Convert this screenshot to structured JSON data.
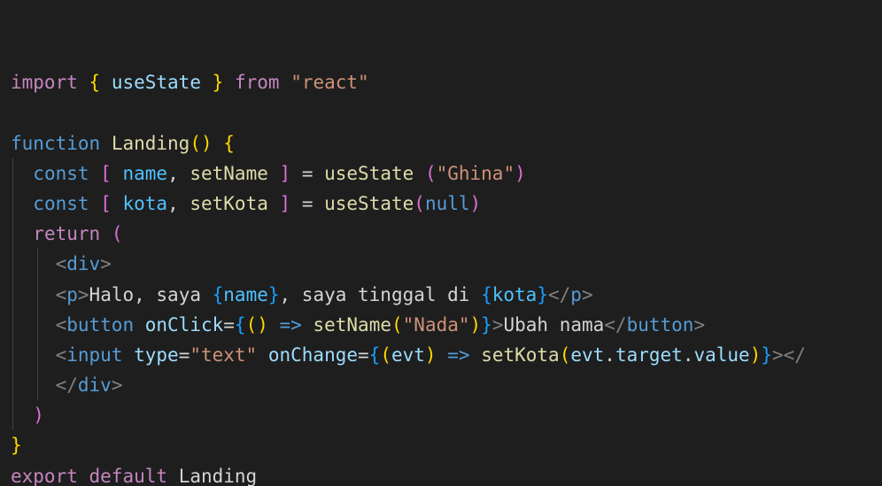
{
  "colors": {
    "background": "#1e1e1e",
    "keyword_control": "#c586c0",
    "keyword_storage": "#569cd6",
    "function": "#dcdcaa",
    "variable": "#9cdcfe",
    "constant": "#4fc1ff",
    "string": "#ce9178",
    "tag": "#569cd6",
    "tag_bracket": "#808080",
    "text": "#d4d4d4",
    "bracket_gold": "#ffd700",
    "bracket_violet": "#da70d6",
    "bracket_blue": "#179fff"
  },
  "code_lines": [
    {
      "guides": 0,
      "tokens": []
    },
    {
      "guides": 0,
      "tokens": [
        {
          "t": "import",
          "c": "#c586c0"
        },
        {
          "t": " ",
          "c": "#d4d4d4"
        },
        {
          "t": "{",
          "c": "#ffd700"
        },
        {
          "t": " ",
          "c": "#d4d4d4"
        },
        {
          "t": "useState",
          "c": "#9cdcfe"
        },
        {
          "t": " ",
          "c": "#d4d4d4"
        },
        {
          "t": "}",
          "c": "#ffd700"
        },
        {
          "t": " ",
          "c": "#d4d4d4"
        },
        {
          "t": "from",
          "c": "#c586c0"
        },
        {
          "t": " ",
          "c": "#d4d4d4"
        },
        {
          "t": "\"react\"",
          "c": "#ce9178"
        }
      ]
    },
    {
      "guides": 0,
      "tokens": []
    },
    {
      "guides": 0,
      "tokens": [
        {
          "t": "function",
          "c": "#569cd6"
        },
        {
          "t": " ",
          "c": "#d4d4d4"
        },
        {
          "t": "Landing",
          "c": "#dcdcaa"
        },
        {
          "t": "()",
          "c": "#ffd700"
        },
        {
          "t": " ",
          "c": "#d4d4d4"
        },
        {
          "t": "{",
          "c": "#ffd700"
        }
      ]
    },
    {
      "guides": 1,
      "tokens": [
        {
          "t": "  ",
          "c": "#d4d4d4"
        },
        {
          "t": "const",
          "c": "#569cd6"
        },
        {
          "t": " ",
          "c": "#d4d4d4"
        },
        {
          "t": "[",
          "c": "#da70d6"
        },
        {
          "t": " ",
          "c": "#d4d4d4"
        },
        {
          "t": "name",
          "c": "#4fc1ff"
        },
        {
          "t": ", ",
          "c": "#d4d4d4"
        },
        {
          "t": "setName",
          "c": "#dcdcaa"
        },
        {
          "t": " ",
          "c": "#d4d4d4"
        },
        {
          "t": "]",
          "c": "#da70d6"
        },
        {
          "t": " = ",
          "c": "#d4d4d4"
        },
        {
          "t": "useState",
          "c": "#dcdcaa"
        },
        {
          "t": " ",
          "c": "#d4d4d4"
        },
        {
          "t": "(",
          "c": "#da70d6"
        },
        {
          "t": "\"Ghina\"",
          "c": "#ce9178"
        },
        {
          "t": ")",
          "c": "#da70d6"
        }
      ]
    },
    {
      "guides": 1,
      "tokens": [
        {
          "t": "  ",
          "c": "#d4d4d4"
        },
        {
          "t": "const",
          "c": "#569cd6"
        },
        {
          "t": " ",
          "c": "#d4d4d4"
        },
        {
          "t": "[",
          "c": "#da70d6"
        },
        {
          "t": " ",
          "c": "#d4d4d4"
        },
        {
          "t": "kota",
          "c": "#4fc1ff"
        },
        {
          "t": ", ",
          "c": "#d4d4d4"
        },
        {
          "t": "setKota",
          "c": "#dcdcaa"
        },
        {
          "t": " ",
          "c": "#d4d4d4"
        },
        {
          "t": "]",
          "c": "#da70d6"
        },
        {
          "t": " = ",
          "c": "#d4d4d4"
        },
        {
          "t": "useState",
          "c": "#dcdcaa"
        },
        {
          "t": "(",
          "c": "#da70d6"
        },
        {
          "t": "null",
          "c": "#569cd6"
        },
        {
          "t": ")",
          "c": "#da70d6"
        }
      ]
    },
    {
      "guides": 1,
      "tokens": [
        {
          "t": "  ",
          "c": "#d4d4d4"
        },
        {
          "t": "return",
          "c": "#c586c0"
        },
        {
          "t": " ",
          "c": "#d4d4d4"
        },
        {
          "t": "(",
          "c": "#da70d6"
        }
      ]
    },
    {
      "guides": 2,
      "tokens": [
        {
          "t": "    ",
          "c": "#d4d4d4"
        },
        {
          "t": "<",
          "c": "#808080"
        },
        {
          "t": "div",
          "c": "#569cd6"
        },
        {
          "t": ">",
          "c": "#808080"
        }
      ]
    },
    {
      "guides": 2,
      "tokens": [
        {
          "t": "    ",
          "c": "#d4d4d4"
        },
        {
          "t": "<",
          "c": "#808080"
        },
        {
          "t": "p",
          "c": "#569cd6"
        },
        {
          "t": ">",
          "c": "#808080"
        },
        {
          "t": "Halo, saya ",
          "c": "#d4d4d4"
        },
        {
          "t": "{",
          "c": "#179fff"
        },
        {
          "t": "name",
          "c": "#4fc1ff"
        },
        {
          "t": "}",
          "c": "#179fff"
        },
        {
          "t": ", saya tinggal di ",
          "c": "#d4d4d4"
        },
        {
          "t": "{",
          "c": "#179fff"
        },
        {
          "t": "kota",
          "c": "#4fc1ff"
        },
        {
          "t": "}",
          "c": "#179fff"
        },
        {
          "t": "</",
          "c": "#808080"
        },
        {
          "t": "p",
          "c": "#569cd6"
        },
        {
          "t": ">",
          "c": "#808080"
        }
      ]
    },
    {
      "guides": 2,
      "tokens": [
        {
          "t": "    ",
          "c": "#d4d4d4"
        },
        {
          "t": "<",
          "c": "#808080"
        },
        {
          "t": "button",
          "c": "#569cd6"
        },
        {
          "t": " ",
          "c": "#d4d4d4"
        },
        {
          "t": "onClick",
          "c": "#9cdcfe"
        },
        {
          "t": "=",
          "c": "#d4d4d4"
        },
        {
          "t": "{",
          "c": "#179fff"
        },
        {
          "t": "()",
          "c": "#ffd700"
        },
        {
          "t": " ",
          "c": "#d4d4d4"
        },
        {
          "t": "=>",
          "c": "#569cd6"
        },
        {
          "t": " ",
          "c": "#d4d4d4"
        },
        {
          "t": "setName",
          "c": "#dcdcaa"
        },
        {
          "t": "(",
          "c": "#ffd700"
        },
        {
          "t": "\"Nada\"",
          "c": "#ce9178"
        },
        {
          "t": ")",
          "c": "#ffd700"
        },
        {
          "t": "}",
          "c": "#179fff"
        },
        {
          "t": ">",
          "c": "#808080"
        },
        {
          "t": "Ubah nama",
          "c": "#d4d4d4"
        },
        {
          "t": "</",
          "c": "#808080"
        },
        {
          "t": "button",
          "c": "#569cd6"
        },
        {
          "t": ">",
          "c": "#808080"
        }
      ]
    },
    {
      "guides": 2,
      "tokens": [
        {
          "t": "    ",
          "c": "#d4d4d4"
        },
        {
          "t": "<",
          "c": "#808080"
        },
        {
          "t": "input",
          "c": "#569cd6"
        },
        {
          "t": " ",
          "c": "#d4d4d4"
        },
        {
          "t": "type",
          "c": "#9cdcfe"
        },
        {
          "t": "=",
          "c": "#d4d4d4"
        },
        {
          "t": "\"text\"",
          "c": "#ce9178"
        },
        {
          "t": " ",
          "c": "#d4d4d4"
        },
        {
          "t": "onChange",
          "c": "#9cdcfe"
        },
        {
          "t": "=",
          "c": "#d4d4d4"
        },
        {
          "t": "{",
          "c": "#179fff"
        },
        {
          "t": "(",
          "c": "#ffd700"
        },
        {
          "t": "evt",
          "c": "#9cdcfe"
        },
        {
          "t": ")",
          "c": "#ffd700"
        },
        {
          "t": " ",
          "c": "#d4d4d4"
        },
        {
          "t": "=>",
          "c": "#569cd6"
        },
        {
          "t": " ",
          "c": "#d4d4d4"
        },
        {
          "t": "setKota",
          "c": "#dcdcaa"
        },
        {
          "t": "(",
          "c": "#ffd700"
        },
        {
          "t": "evt",
          "c": "#9cdcfe"
        },
        {
          "t": ".",
          "c": "#d4d4d4"
        },
        {
          "t": "target",
          "c": "#9cdcfe"
        },
        {
          "t": ".",
          "c": "#d4d4d4"
        },
        {
          "t": "value",
          "c": "#9cdcfe"
        },
        {
          "t": ")",
          "c": "#ffd700"
        },
        {
          "t": "}",
          "c": "#179fff"
        },
        {
          "t": "></",
          "c": "#808080"
        }
      ]
    },
    {
      "guides": 2,
      "tokens": [
        {
          "t": "    ",
          "c": "#d4d4d4"
        },
        {
          "t": "</",
          "c": "#808080"
        },
        {
          "t": "div",
          "c": "#569cd6"
        },
        {
          "t": ">",
          "c": "#808080"
        }
      ]
    },
    {
      "guides": 1,
      "tokens": [
        {
          "t": "  ",
          "c": "#d4d4d4"
        },
        {
          "t": ")",
          "c": "#da70d6"
        }
      ]
    },
    {
      "guides": 0,
      "tokens": [
        {
          "t": "}",
          "c": "#ffd700"
        }
      ]
    },
    {
      "guides": 0,
      "tokens": [
        {
          "t": "export",
          "c": "#c586c0"
        },
        {
          "t": " ",
          "c": "#d4d4d4"
        },
        {
          "t": "default",
          "c": "#c586c0"
        },
        {
          "t": " ",
          "c": "#d4d4d4"
        },
        {
          "t": "Landing",
          "c": "#d4d4d4"
        }
      ]
    }
  ]
}
